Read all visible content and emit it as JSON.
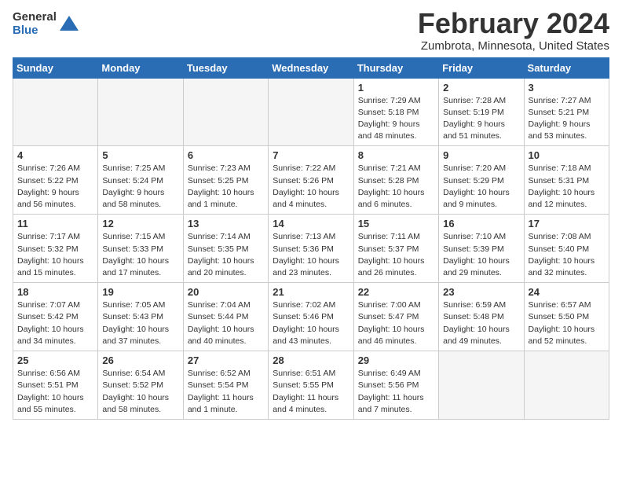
{
  "logo": {
    "general": "General",
    "blue": "Blue"
  },
  "title": "February 2024",
  "location": "Zumbrota, Minnesota, United States",
  "headers": [
    "Sunday",
    "Monday",
    "Tuesday",
    "Wednesday",
    "Thursday",
    "Friday",
    "Saturday"
  ],
  "weeks": [
    [
      {
        "day": "",
        "text": ""
      },
      {
        "day": "",
        "text": ""
      },
      {
        "day": "",
        "text": ""
      },
      {
        "day": "",
        "text": ""
      },
      {
        "day": "1",
        "text": "Sunrise: 7:29 AM\nSunset: 5:18 PM\nDaylight: 9 hours\nand 48 minutes."
      },
      {
        "day": "2",
        "text": "Sunrise: 7:28 AM\nSunset: 5:19 PM\nDaylight: 9 hours\nand 51 minutes."
      },
      {
        "day": "3",
        "text": "Sunrise: 7:27 AM\nSunset: 5:21 PM\nDaylight: 9 hours\nand 53 minutes."
      }
    ],
    [
      {
        "day": "4",
        "text": "Sunrise: 7:26 AM\nSunset: 5:22 PM\nDaylight: 9 hours\nand 56 minutes."
      },
      {
        "day": "5",
        "text": "Sunrise: 7:25 AM\nSunset: 5:24 PM\nDaylight: 9 hours\nand 58 minutes."
      },
      {
        "day": "6",
        "text": "Sunrise: 7:23 AM\nSunset: 5:25 PM\nDaylight: 10 hours\nand 1 minute."
      },
      {
        "day": "7",
        "text": "Sunrise: 7:22 AM\nSunset: 5:26 PM\nDaylight: 10 hours\nand 4 minutes."
      },
      {
        "day": "8",
        "text": "Sunrise: 7:21 AM\nSunset: 5:28 PM\nDaylight: 10 hours\nand 6 minutes."
      },
      {
        "day": "9",
        "text": "Sunrise: 7:20 AM\nSunset: 5:29 PM\nDaylight: 10 hours\nand 9 minutes."
      },
      {
        "day": "10",
        "text": "Sunrise: 7:18 AM\nSunset: 5:31 PM\nDaylight: 10 hours\nand 12 minutes."
      }
    ],
    [
      {
        "day": "11",
        "text": "Sunrise: 7:17 AM\nSunset: 5:32 PM\nDaylight: 10 hours\nand 15 minutes."
      },
      {
        "day": "12",
        "text": "Sunrise: 7:15 AM\nSunset: 5:33 PM\nDaylight: 10 hours\nand 17 minutes."
      },
      {
        "day": "13",
        "text": "Sunrise: 7:14 AM\nSunset: 5:35 PM\nDaylight: 10 hours\nand 20 minutes."
      },
      {
        "day": "14",
        "text": "Sunrise: 7:13 AM\nSunset: 5:36 PM\nDaylight: 10 hours\nand 23 minutes."
      },
      {
        "day": "15",
        "text": "Sunrise: 7:11 AM\nSunset: 5:37 PM\nDaylight: 10 hours\nand 26 minutes."
      },
      {
        "day": "16",
        "text": "Sunrise: 7:10 AM\nSunset: 5:39 PM\nDaylight: 10 hours\nand 29 minutes."
      },
      {
        "day": "17",
        "text": "Sunrise: 7:08 AM\nSunset: 5:40 PM\nDaylight: 10 hours\nand 32 minutes."
      }
    ],
    [
      {
        "day": "18",
        "text": "Sunrise: 7:07 AM\nSunset: 5:42 PM\nDaylight: 10 hours\nand 34 minutes."
      },
      {
        "day": "19",
        "text": "Sunrise: 7:05 AM\nSunset: 5:43 PM\nDaylight: 10 hours\nand 37 minutes."
      },
      {
        "day": "20",
        "text": "Sunrise: 7:04 AM\nSunset: 5:44 PM\nDaylight: 10 hours\nand 40 minutes."
      },
      {
        "day": "21",
        "text": "Sunrise: 7:02 AM\nSunset: 5:46 PM\nDaylight: 10 hours\nand 43 minutes."
      },
      {
        "day": "22",
        "text": "Sunrise: 7:00 AM\nSunset: 5:47 PM\nDaylight: 10 hours\nand 46 minutes."
      },
      {
        "day": "23",
        "text": "Sunrise: 6:59 AM\nSunset: 5:48 PM\nDaylight: 10 hours\nand 49 minutes."
      },
      {
        "day": "24",
        "text": "Sunrise: 6:57 AM\nSunset: 5:50 PM\nDaylight: 10 hours\nand 52 minutes."
      }
    ],
    [
      {
        "day": "25",
        "text": "Sunrise: 6:56 AM\nSunset: 5:51 PM\nDaylight: 10 hours\nand 55 minutes."
      },
      {
        "day": "26",
        "text": "Sunrise: 6:54 AM\nSunset: 5:52 PM\nDaylight: 10 hours\nand 58 minutes."
      },
      {
        "day": "27",
        "text": "Sunrise: 6:52 AM\nSunset: 5:54 PM\nDaylight: 11 hours\nand 1 minute."
      },
      {
        "day": "28",
        "text": "Sunrise: 6:51 AM\nSunset: 5:55 PM\nDaylight: 11 hours\nand 4 minutes."
      },
      {
        "day": "29",
        "text": "Sunrise: 6:49 AM\nSunset: 5:56 PM\nDaylight: 11 hours\nand 7 minutes."
      },
      {
        "day": "",
        "text": ""
      },
      {
        "day": "",
        "text": ""
      }
    ]
  ]
}
